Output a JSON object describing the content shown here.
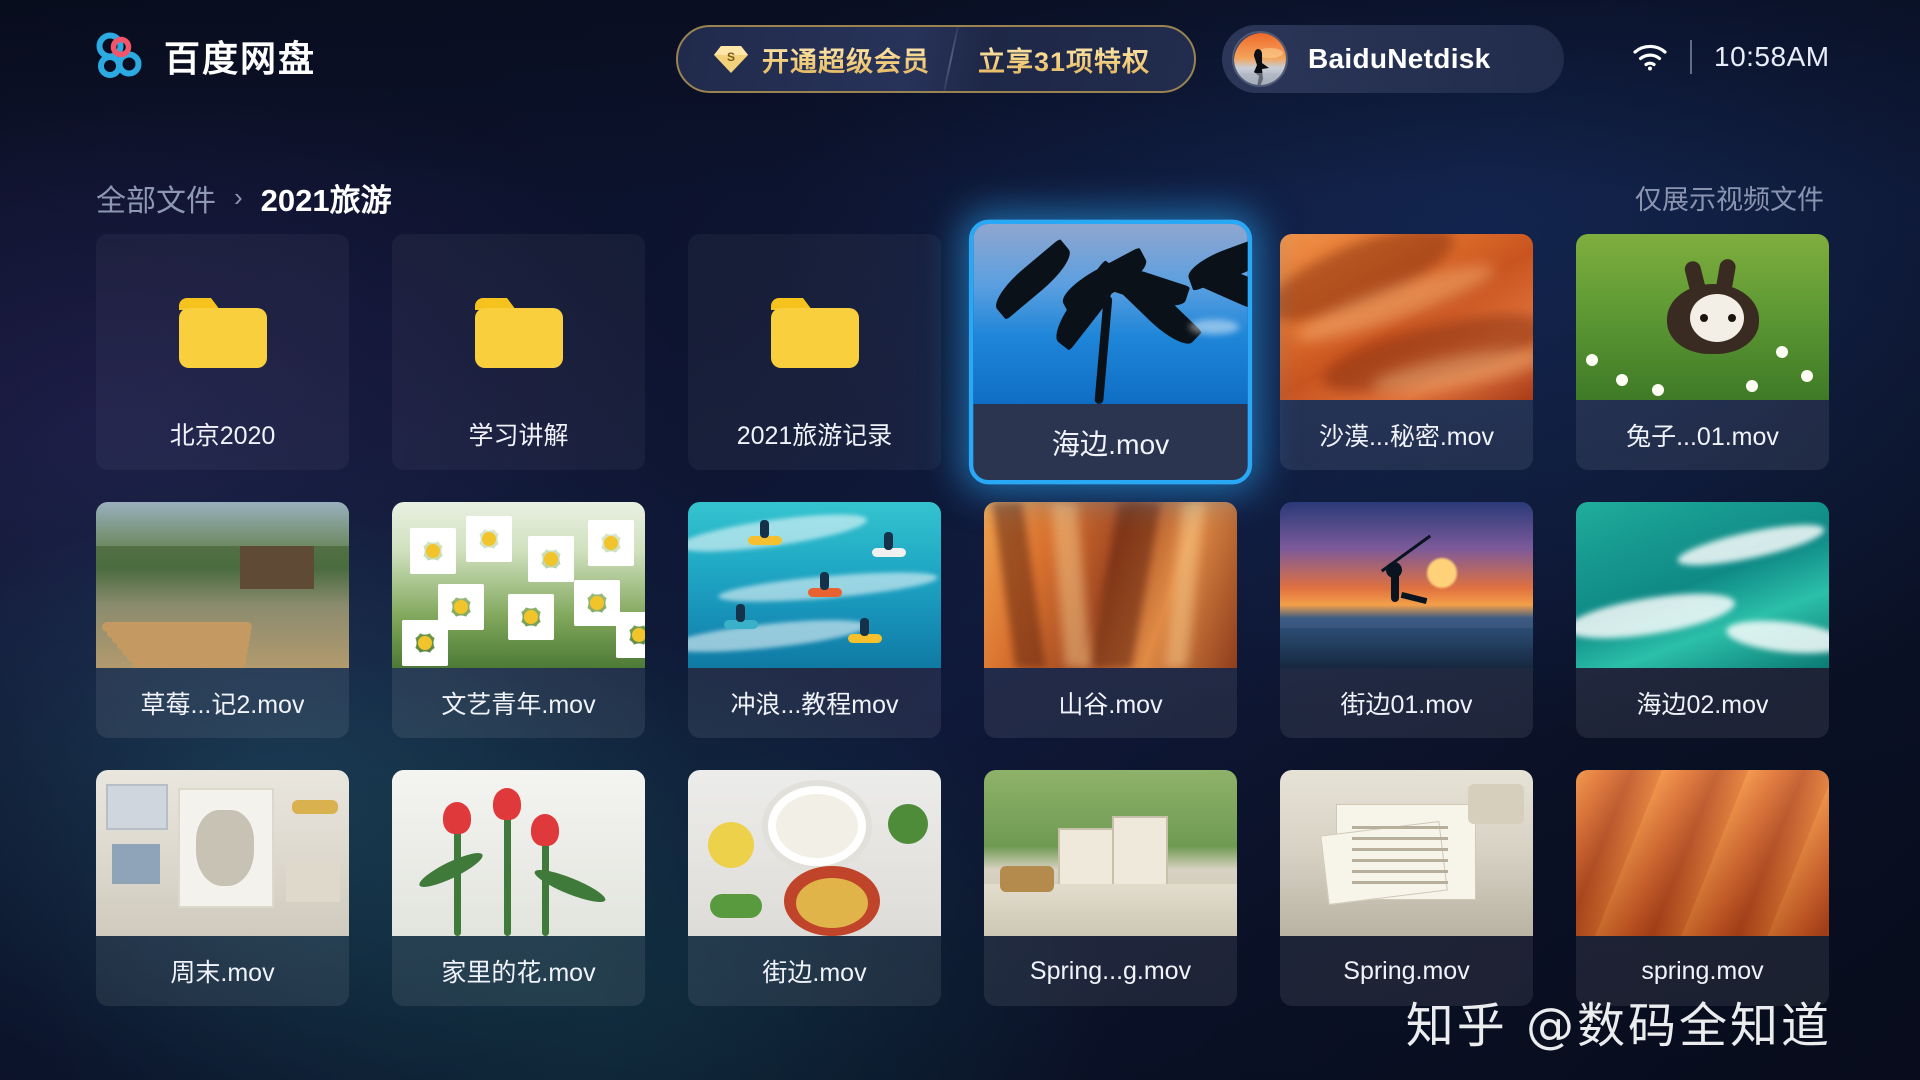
{
  "app": {
    "brand_name": "百度网盘",
    "brand_logo_icon": "baidu-cloud-logo-icon"
  },
  "topbar": {
    "vip_banner": {
      "gem_icon": "vip-gem-icon",
      "primary_label": "开通超级会员",
      "secondary_label": "立享31项特权"
    },
    "user": {
      "avatar_icon": "user-avatar-icon",
      "name": "BaiduNetdisk"
    },
    "status": {
      "wifi_icon": "wifi-icon",
      "time": "10:58AM"
    }
  },
  "breadcrumb": {
    "root_label": "全部文件",
    "separator": "›",
    "current_label": "2021旅游"
  },
  "filter_note": "仅展示视频文件",
  "grid": {
    "items": [
      {
        "label": "北京2020",
        "type": "folder",
        "selected": false,
        "icon": "folder-icon",
        "scene": ""
      },
      {
        "label": "学习讲解",
        "type": "folder",
        "selected": false,
        "icon": "folder-icon",
        "scene": ""
      },
      {
        "label": "2021旅游记录",
        "type": "folder",
        "selected": false,
        "icon": "folder-icon",
        "scene": ""
      },
      {
        "label": "海边.mov",
        "type": "video",
        "selected": true,
        "icon": "video-thumbnail",
        "scene": "palm"
      },
      {
        "label": "沙漠...秘密.mov",
        "type": "video",
        "selected": false,
        "icon": "video-thumbnail",
        "scene": "dune"
      },
      {
        "label": "兔子...01.mov",
        "type": "video",
        "selected": false,
        "icon": "video-thumbnail",
        "scene": "rabbit"
      },
      {
        "label": "草莓...记2.mov",
        "type": "video",
        "selected": false,
        "icon": "video-thumbnail",
        "scene": "cabin"
      },
      {
        "label": "文艺青年.mov",
        "type": "video",
        "selected": false,
        "icon": "video-thumbnail",
        "scene": "daisy"
      },
      {
        "label": "冲浪...教程mov",
        "type": "video",
        "selected": false,
        "icon": "video-thumbnail",
        "scene": "surf"
      },
      {
        "label": "山谷.mov",
        "type": "video",
        "selected": false,
        "icon": "video-thumbnail",
        "scene": "canyon"
      },
      {
        "label": "街边01.mov",
        "type": "video",
        "selected": false,
        "icon": "video-thumbnail",
        "scene": "sunset"
      },
      {
        "label": "海边02.mov",
        "type": "video",
        "selected": false,
        "icon": "video-thumbnail",
        "scene": "sea"
      },
      {
        "label": "周末.mov",
        "type": "video",
        "selected": false,
        "icon": "video-thumbnail",
        "scene": "desk"
      },
      {
        "label": "家里的花.mov",
        "type": "video",
        "selected": false,
        "icon": "video-thumbnail",
        "scene": "tulip"
      },
      {
        "label": "街边.mov",
        "type": "video",
        "selected": false,
        "icon": "video-thumbnail",
        "scene": "food"
      },
      {
        "label": "Spring...g.mov",
        "type": "video",
        "selected": false,
        "icon": "video-thumbnail",
        "scene": "picnic"
      },
      {
        "label": "Spring.mov",
        "type": "video",
        "selected": false,
        "icon": "video-thumbnail",
        "scene": "book"
      },
      {
        "label": "spring.mov",
        "type": "video",
        "selected": false,
        "icon": "video-thumbnail",
        "scene": "stripe"
      }
    ]
  },
  "watermark": "知乎 @数码全知道",
  "colors": {
    "selection_blue": "#29a8f5",
    "folder_yellow": "#f9cf3e",
    "vip_gold": "#f0cf86",
    "brand_blue": "#2cabe3",
    "page_bg": "#0a0f22"
  }
}
